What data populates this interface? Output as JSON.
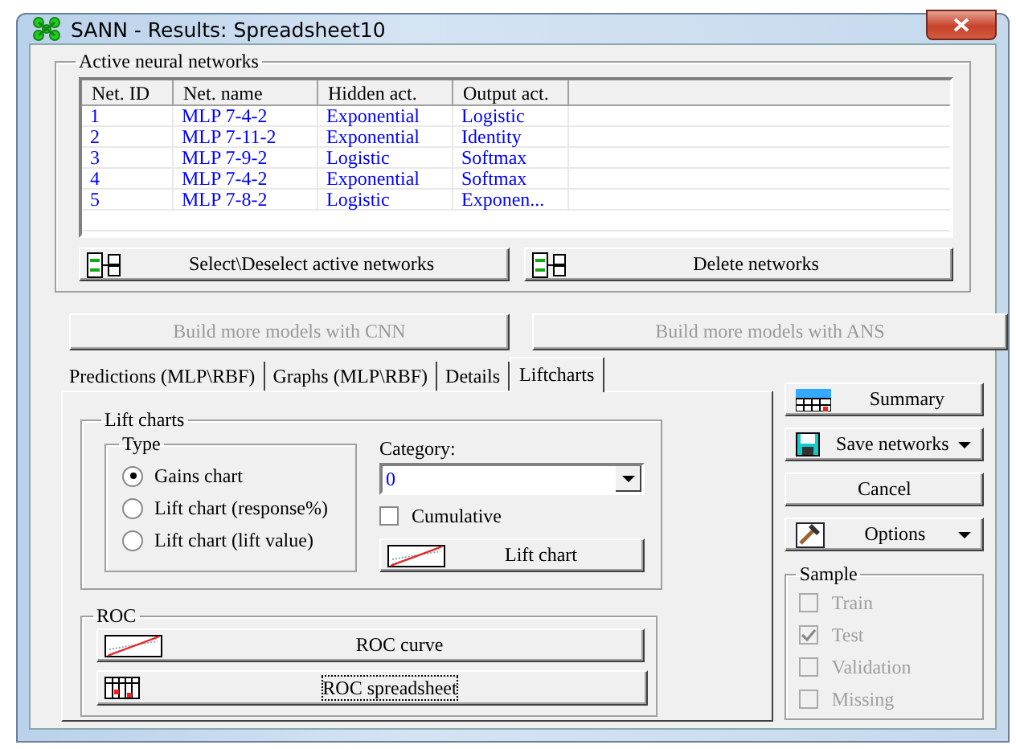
{
  "window": {
    "title": "SANN - Results: Spreadsheet10"
  },
  "networks": {
    "title": "Active neural networks",
    "columns": [
      "Net. ID",
      "Net. name",
      "Hidden act.",
      "Output act."
    ],
    "rows": [
      [
        "1",
        "MLP 7-4-2",
        "Exponential",
        "Logistic"
      ],
      [
        "2",
        "MLP 7-11-2",
        "Exponential",
        "Identity"
      ],
      [
        "3",
        "MLP 7-9-2",
        "Logistic",
        "Softmax"
      ],
      [
        "4",
        "MLP 7-4-2",
        "Exponential",
        "Softmax"
      ],
      [
        "5",
        "MLP 7-8-2",
        "Logistic",
        "Exponen..."
      ]
    ],
    "buttons": [
      {
        "label": "Select\\Deselect active networks"
      },
      {
        "label": "Delete networks"
      }
    ]
  },
  "build_buttons": [
    {
      "label": "Build more models with CNN",
      "disabled": true
    },
    {
      "label": "Build more models with ANS",
      "disabled": true
    }
  ],
  "tabs": [
    {
      "label": "Predictions (MLP\\RBF)",
      "selected": false
    },
    {
      "label": "Graphs (MLP\\RBF)",
      "selected": false
    },
    {
      "label": "Details",
      "selected": false
    },
    {
      "label": "Liftcharts",
      "selected": true
    }
  ],
  "lift_charts": {
    "title": "Lift charts",
    "type_title": "Type",
    "types": [
      {
        "label": "Gains chart",
        "selected": true
      },
      {
        "label": "Lift chart (response%)",
        "selected": false
      },
      {
        "label": "Lift chart (lift value)",
        "selected": false
      }
    ],
    "category_label": "Category:",
    "category_value": "0",
    "cumulative": {
      "label": "Cumulative",
      "checked": false
    },
    "button": "Lift chart"
  },
  "roc": {
    "title": "ROC",
    "buttons": [
      {
        "label": "ROC curve",
        "kind": "curve",
        "focused": false
      },
      {
        "label": "ROC spreadsheet",
        "kind": "spreadsheet",
        "focused": true
      }
    ]
  },
  "side_buttons": [
    {
      "label": "Summary",
      "kind": "summary",
      "menu": false
    },
    {
      "label": "Save networks",
      "kind": "save",
      "menu": true
    },
    {
      "label": "Cancel",
      "kind": "plain",
      "menu": false
    },
    {
      "label": "Options",
      "kind": "options",
      "menu": true
    }
  ],
  "sample": {
    "title": "Sample",
    "items": [
      {
        "label": "Train",
        "checked": false,
        "disabled": true
      },
      {
        "label": "Test",
        "checked": true,
        "disabled": true
      },
      {
        "label": "Validation",
        "checked": false,
        "disabled": true
      },
      {
        "label": "Missing",
        "checked": false,
        "disabled": true
      }
    ]
  }
}
